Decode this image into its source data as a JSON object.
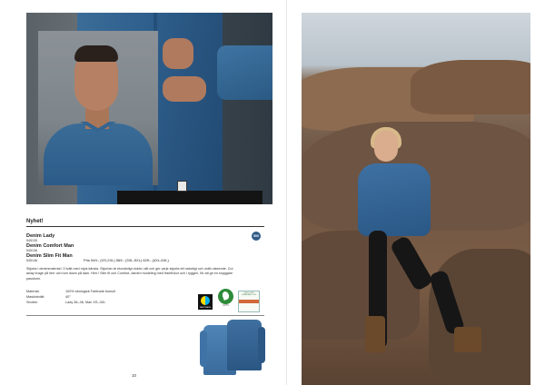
{
  "section_title": "Nyhet!",
  "badge": "500",
  "products": [
    {
      "name": "Denim Lady",
      "code": "545135"
    },
    {
      "name": "Denim Comfort Man",
      "code": "545136"
    },
    {
      "name": "Denim Slim Fit Man",
      "code": "545146"
    }
  ],
  "price_text": "Pris 549:- (XS-2XL) 569:- (3XL-5XL) 629:- (4XL-6XL)",
  "description": "Skjorta i denimmaterial i 3 tvätt med mjuk känsla. Skjortan är ekovänligt dolda i allt och ger varje skjorta ett naturligt och unikt utseende. Cut away krage på herr och turn down på dam. Herr i Slim fit och Comfort, damen modeling med framfickor och i ryggen, för att ge en snyggare passform.",
  "specs": [
    {
      "label": "Material:",
      "value": "100% ekologisk Fairtrade bomull"
    },
    {
      "label": "Maskintvätt:",
      "value": "40°"
    },
    {
      "label": "Storlek:",
      "value": "Lady 36–46, Man XS–3XL"
    }
  ],
  "certs": {
    "fairtrade": "FAIRTRADE",
    "gots": "GOTS",
    "oeko": "OEKO-TEX STANDARD 100"
  },
  "page_number": "10"
}
